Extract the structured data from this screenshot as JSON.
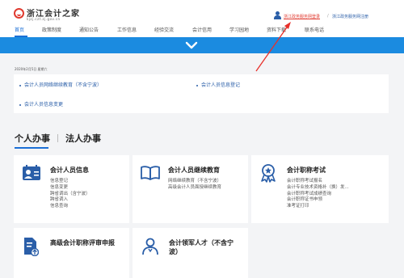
{
  "header": {
    "logo_title": "浙江会计之家",
    "logo_sub": "kjzj.czt.zj.gov.cn",
    "login_link": "浙江政务服务网登录",
    "separator": "/",
    "register_link": "浙江政务服务网注册"
  },
  "nav": {
    "items": [
      "首页",
      "政策制度",
      "通知公告",
      "工作信息",
      "经验交流",
      "会计信用",
      "学习园地",
      "资料下载",
      "联系电话"
    ]
  },
  "notice": {
    "date": "2020年2月5日 星期六",
    "items": [
      "会计人员网络继续教育（不含宁波）",
      "会计人员信息登记",
      "会计人员信息变更"
    ]
  },
  "tabs": {
    "personal": "个人办事",
    "legal": "法人办事"
  },
  "cards": [
    {
      "title": "会计人员信息",
      "icon": "id-card-icon",
      "lines": [
        "信息登记",
        "信息变更",
        "跨省调出（含宁波）",
        "跨省调入",
        "信息查询"
      ]
    },
    {
      "title": "会计人员继续教育",
      "icon": "open-book-icon",
      "lines": [
        "网络继续教育（不含宁波）",
        "高级会计人员面授继续教育"
      ]
    },
    {
      "title": "会计职称考试",
      "icon": "award-medal-icon",
      "lines": [
        "会计职称考试报名",
        "会计专业技术资格补（换）发...",
        "会计职称考试成绩查询",
        "会计职称证书申领",
        "准考证打印"
      ]
    },
    {
      "title": "高级会计职称评审申报",
      "icon": "upload-document-icon",
      "lines": []
    },
    {
      "title": "会计领军人才（不含宁",
      "title2": "波）",
      "icon": "talent-user-icon",
      "lines": []
    }
  ],
  "colors": {
    "brand_blue": "#1b6fd6",
    "banner_blue": "#1b8be0",
    "link_blue": "#2a5ea8",
    "logo_red": "#e03a2f",
    "annotation_red": "#e8302a"
  }
}
